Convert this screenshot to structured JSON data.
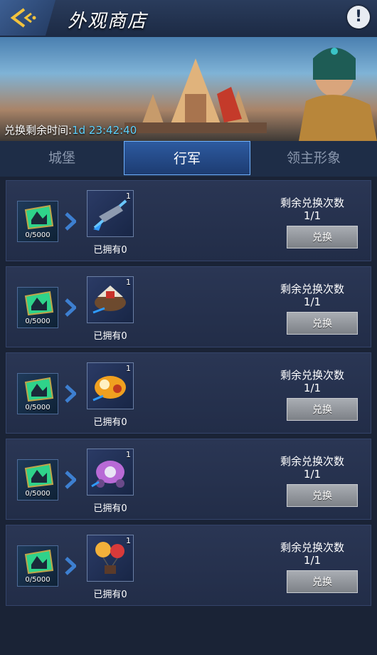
{
  "header": {
    "title": "外观商店",
    "help_symbol": "!"
  },
  "banner": {
    "timer_label": "兑换剩余时间:",
    "timer_value": "1d 23:42:40"
  },
  "tabs": [
    {
      "label": "城堡",
      "active": false
    },
    {
      "label": "行军",
      "active": true
    },
    {
      "label": "领主形象",
      "active": false
    }
  ],
  "items": [
    {
      "cost": "0/5000",
      "count": "1",
      "owned": "已拥有0",
      "remain_label": "剩余兑换次数",
      "remain": "1/1",
      "button": "兑换",
      "icon": "blue-dragon-bow-icon"
    },
    {
      "cost": "0/5000",
      "count": "1",
      "owned": "已拥有0",
      "remain_label": "剩余兑换次数",
      "remain": "1/1",
      "button": "兑换",
      "icon": "war-chariot-icon"
    },
    {
      "cost": "0/5000",
      "count": "1",
      "owned": "已拥有0",
      "remain_label": "剩余兑换次数",
      "remain": "1/1",
      "button": "兑换",
      "icon": "golden-beast-chariot-icon"
    },
    {
      "cost": "0/5000",
      "count": "1",
      "owned": "已拥有0",
      "remain_label": "剩余兑换次数",
      "remain": "1/1",
      "button": "兑换",
      "icon": "purple-carriage-icon"
    },
    {
      "cost": "0/5000",
      "count": "1",
      "owned": "已拥有0",
      "remain_label": "剩余兑换次数",
      "remain": "1/1",
      "button": "兑换",
      "icon": "balloon-ship-icon"
    }
  ],
  "colors": {
    "timer": "#5fd3ff",
    "tab_active": "#2d5aa0",
    "button": "#9a9ea4"
  }
}
